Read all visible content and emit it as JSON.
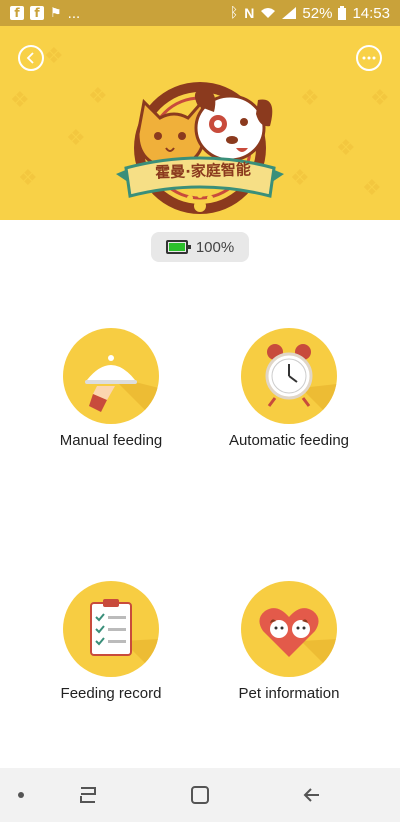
{
  "statusbar": {
    "notification_overflow": "...",
    "battery_percent": "52%",
    "time": "14:53"
  },
  "header": {
    "brand_text": "霍曼·家庭智能"
  },
  "battery": {
    "label": "100%",
    "level": 1.0,
    "fill_color": "#2cbf2c"
  },
  "tiles": [
    {
      "label": "Manual feeding",
      "icon": "food-cloche-icon"
    },
    {
      "label": "Automatic feeding",
      "icon": "alarm-clock-icon"
    },
    {
      "label": "Feeding record",
      "icon": "clipboard-checklist-icon"
    },
    {
      "label": "Pet information",
      "icon": "heart-pets-icon"
    }
  ],
  "colors": {
    "header_yellow": "#f8d147",
    "tile_yellow": "#f7cd42",
    "brand_brown": "#8b3a1e",
    "status_gold": "#c9a23a"
  }
}
